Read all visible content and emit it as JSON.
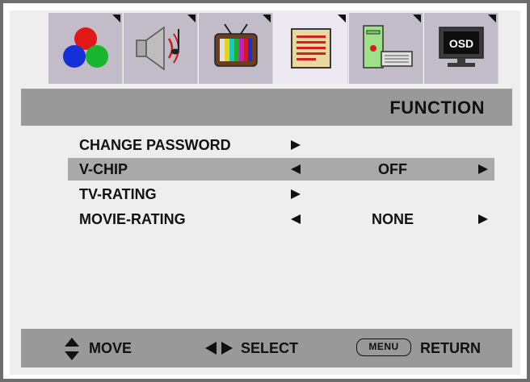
{
  "tabs": [
    {
      "icon": "color-balls-icon",
      "active": false
    },
    {
      "icon": "speaker-icon",
      "active": false
    },
    {
      "icon": "tv-icon",
      "active": false
    },
    {
      "icon": "document-icon",
      "active": true
    },
    {
      "icon": "computer-icon",
      "active": false
    },
    {
      "icon": "osd-monitor-icon",
      "label": "OSD",
      "active": false
    }
  ],
  "title": "FUNCTION",
  "menu": {
    "items": [
      {
        "label": "CHANGE PASSWORD",
        "value": "",
        "has_left": false,
        "has_right": true,
        "selected": false
      },
      {
        "label": "V-CHIP",
        "value": "OFF",
        "has_left": true,
        "has_right": true,
        "selected": true
      },
      {
        "label": "TV-RATING",
        "value": "",
        "has_left": false,
        "has_right": true,
        "selected": false
      },
      {
        "label": "MOVIE-RATING",
        "value": "NONE",
        "has_left": true,
        "has_right": true,
        "selected": false
      }
    ]
  },
  "footer": {
    "move_label": "MOVE",
    "select_label": "SELECT",
    "menu_key": "MENU",
    "return_label": "RETURN"
  }
}
